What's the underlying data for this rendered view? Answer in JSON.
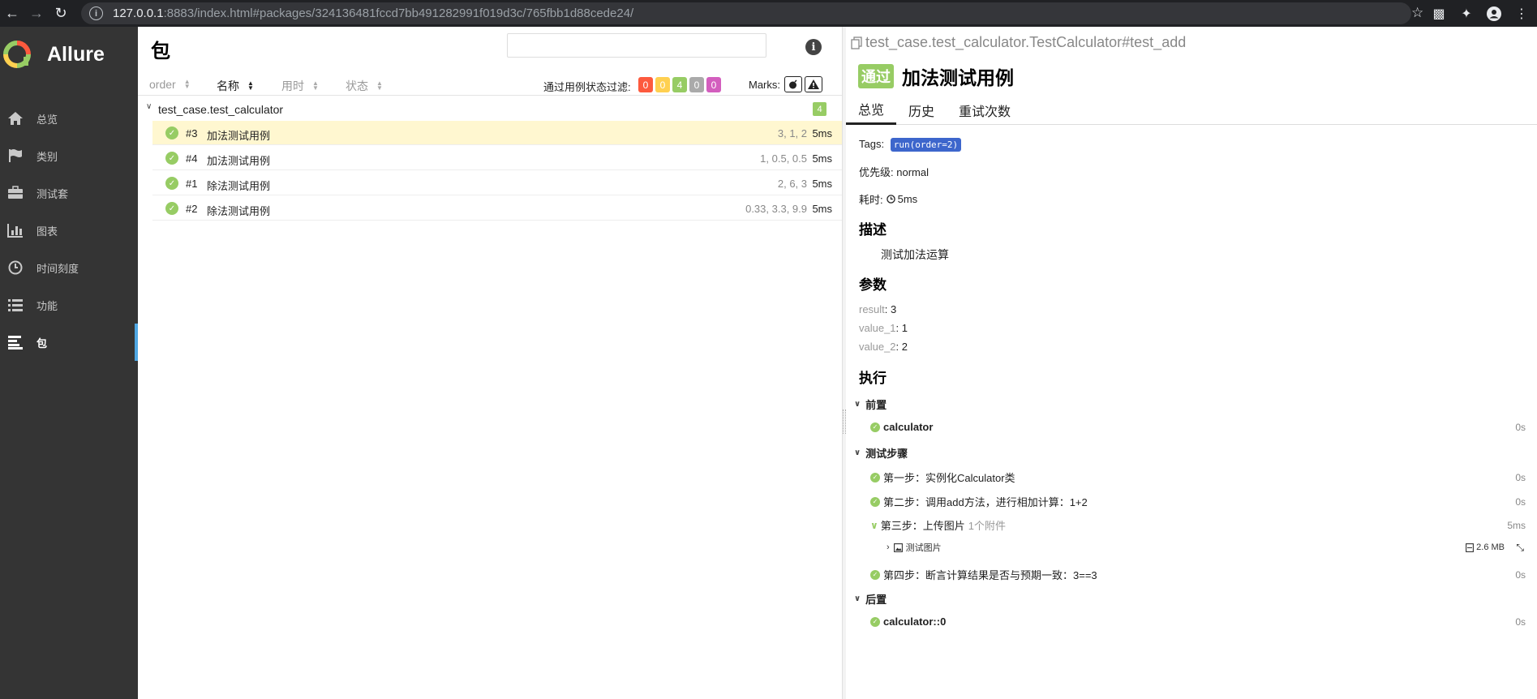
{
  "browser": {
    "url_host": "127.0.0.1",
    "url_rest": ":8883/index.html#packages/324136481fccd7bb491282991f019d3c/765fbb1d88cede24/"
  },
  "sidebar": {
    "brand": "Allure",
    "items": [
      {
        "label": "总览",
        "icon": "home-icon"
      },
      {
        "label": "类别",
        "icon": "flag-icon"
      },
      {
        "label": "测试套",
        "icon": "briefcase-icon"
      },
      {
        "label": "图表",
        "icon": "bar-chart-icon"
      },
      {
        "label": "时间刻度",
        "icon": "clock-icon"
      },
      {
        "label": "功能",
        "icon": "list-icon"
      },
      {
        "label": "包",
        "icon": "align-left-icon",
        "active": true
      }
    ]
  },
  "packages": {
    "title": "包",
    "search_placeholder": "",
    "sort_columns": [
      "order",
      "名称",
      "用时",
      "状态"
    ],
    "active_sort": "名称",
    "filter_label": "通过用例状态过滤:",
    "status_counts": [
      {
        "value": "0",
        "color": "#fd5a3e"
      },
      {
        "value": "0",
        "color": "#ffd050"
      },
      {
        "value": "4",
        "color": "#97cc64"
      },
      {
        "value": "0",
        "color": "#aaaaaa"
      },
      {
        "value": "0",
        "color": "#d35ebe"
      }
    ],
    "marks_label": "Marks:",
    "group": {
      "name": "test_case.test_calculator",
      "count": "4"
    },
    "tests": [
      {
        "num": "#3",
        "name": "加法测试用例",
        "params": "3, 1, 2",
        "duration": "5ms",
        "selected": true
      },
      {
        "num": "#4",
        "name": "加法测试用例",
        "params": "1, 0.5, 0.5",
        "duration": "5ms"
      },
      {
        "num": "#1",
        "name": "除法测试用例",
        "params": "2, 6, 3",
        "duration": "5ms"
      },
      {
        "num": "#2",
        "name": "除法测试用例",
        "params": "0.33, 3.3, 9.9",
        "duration": "5ms"
      }
    ]
  },
  "detail": {
    "full_name": "test_case.test_calculator.TestCalculator#test_add",
    "status": "通过",
    "title": "加法测试用例",
    "tabs": [
      "总览",
      "历史",
      "重试次数"
    ],
    "tags_label": "Tags:",
    "tag": "run(order=2)",
    "severity_label": "优先级:",
    "severity": "normal",
    "duration_label": "耗时:",
    "duration": "5ms",
    "description_h": "描述",
    "description": "测试加法运算",
    "params_h": "参数",
    "params": [
      {
        "key": "result",
        "value": "3"
      },
      {
        "key": "value_1",
        "value": "1"
      },
      {
        "key": "value_2",
        "value": "2"
      }
    ],
    "execution_h": "执行",
    "setup_h": "前置",
    "setup": {
      "name": "calculator",
      "time": "0s"
    },
    "steps_h": "测试步骤",
    "steps": [
      {
        "label": "第一步：实例化Calculator类",
        "time": "0s"
      },
      {
        "label": "第二步：调用add方法，进行相加计算：1+2",
        "time": "0s"
      },
      {
        "label": "第三步：上传图片",
        "attach_count": "1个附件",
        "time": "5ms"
      },
      {
        "label": "第四步：断言计算结果是否与预期一致：3==3",
        "time": "0s"
      }
    ],
    "attachment": {
      "name": "测试图片",
      "size": "2.6 MB"
    },
    "teardown_h": "后置",
    "teardown": {
      "name": "calculator::0",
      "time": "0s"
    }
  }
}
